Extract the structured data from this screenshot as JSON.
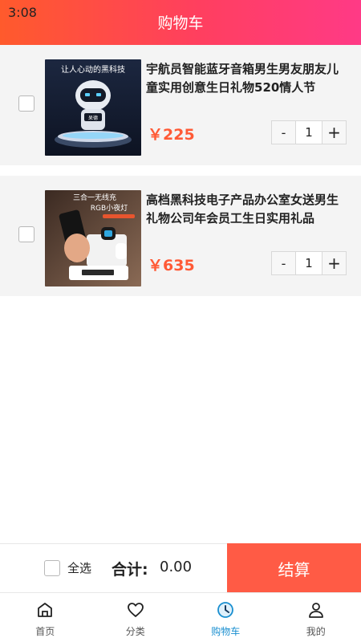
{
  "status": {
    "time": "3:08"
  },
  "header": {
    "title": "购物车"
  },
  "items": [
    {
      "title": "宇航员智能蓝牙音箱男生男友朋友儿童实用创意生日礼物520情人节",
      "price": "￥225",
      "quantity": "1",
      "image_text": [
        "让人心动的黑科技"
      ],
      "image_screen_text": "呆德"
    },
    {
      "title": "高档黑科技电子产品办公室女送男生礼物公司年会员工生日实用礼品",
      "price": "￥635",
      "quantity": "1",
      "image_text": [
        "三合一无线充",
        "RGB小夜灯"
      ],
      "image_screen_text": ""
    }
  ],
  "stepper": {
    "minus": "-",
    "plus": "+"
  },
  "bottom": {
    "select_all": "全选",
    "total_label": "合计:",
    "total_value": "0.00",
    "checkout": "结算"
  },
  "tabs": [
    {
      "label": "首页",
      "icon": "home-icon"
    },
    {
      "label": "分类",
      "icon": "heart-icon"
    },
    {
      "label": "购物车",
      "icon": "cart-clock-icon",
      "active": true
    },
    {
      "label": "我的",
      "icon": "user-icon"
    }
  ],
  "colors": {
    "header_start": "#ff5a2c",
    "header_end": "#ff3a86",
    "price": "#ff5a36",
    "checkout": "#ff5b45",
    "active_tab": "#1a8fd0"
  }
}
